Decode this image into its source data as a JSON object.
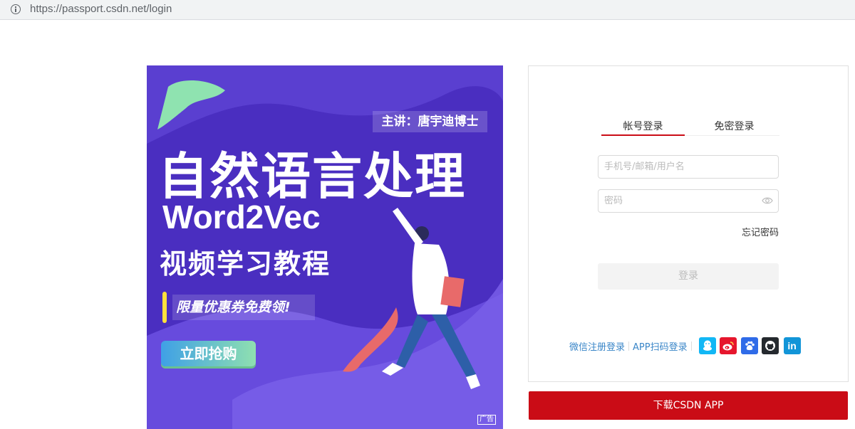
{
  "browser": {
    "url": "https://passport.csdn.net/login"
  },
  "ad": {
    "speaker": "主讲：唐宇迪博士",
    "title": "自然语言处理",
    "subtitle1": "Word2Vec",
    "subtitle2": "视频学习教程",
    "coupon": "限量优惠券免费领!",
    "buy_button": "立即抢购",
    "ad_label": "广告",
    "colors": {
      "background": "#4a2ec0",
      "accent_yellow": "#ffe03c"
    }
  },
  "login": {
    "tabs": [
      {
        "label": "帐号登录",
        "active": true
      },
      {
        "label": "免密登录",
        "active": false
      }
    ],
    "username_placeholder": "手机号/邮箱/用户名",
    "password_placeholder": "密码",
    "forgot_password": "忘记密码",
    "login_button": "登录",
    "wechat_login": "微信注册登录",
    "app_scan_login": "APP扫码登录",
    "social_icons": [
      "qq-icon",
      "weibo-icon",
      "baidu-icon",
      "github-icon",
      "linkedin-icon"
    ],
    "linkedin_text": "in",
    "colors": {
      "brand_red": "#ca0c16",
      "link_blue": "#3a86c8"
    }
  },
  "download_button": "下载CSDN APP"
}
